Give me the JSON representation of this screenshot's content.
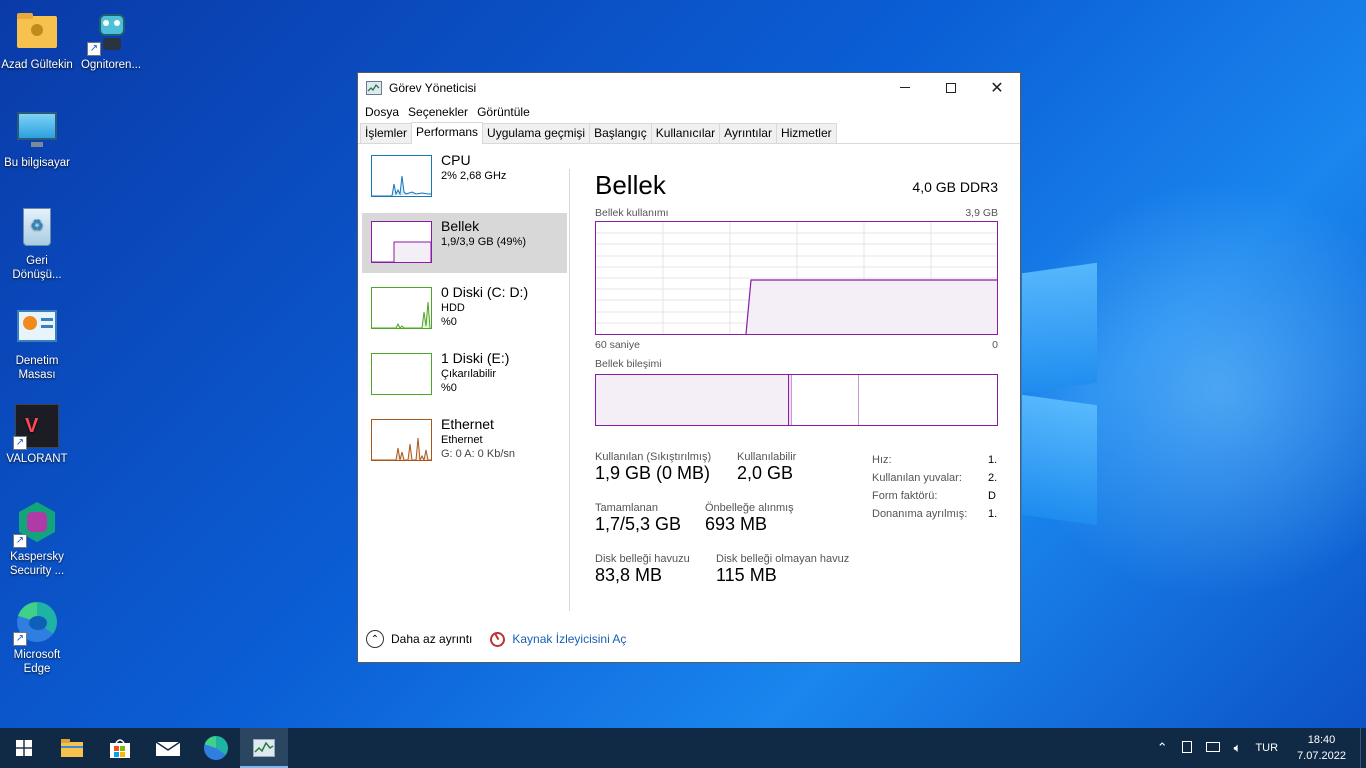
{
  "desktop": {
    "icons": [
      {
        "label": "Azad Gültekin",
        "icon": "user-folder-icon"
      },
      {
        "label": "Ognitoren...",
        "icon": "robot-app-icon"
      },
      {
        "label": "Bu bilgisayar",
        "icon": "monitor-icon"
      },
      {
        "label": "Geri Dönüşü...",
        "icon": "recycle-bin-icon"
      },
      {
        "label": "Denetim Masası",
        "icon": "control-panel-icon"
      },
      {
        "label": "VALORANT",
        "icon": "valorant-icon"
      },
      {
        "label": "Kaspersky Security ...",
        "icon": "kaspersky-icon"
      },
      {
        "label": "Microsoft Edge",
        "icon": "edge-icon"
      }
    ]
  },
  "window": {
    "title": "Görev Yöneticisi",
    "menu": [
      "Dosya",
      "Seçenekler",
      "Görüntüle"
    ],
    "tabs": [
      "İşlemler",
      "Performans",
      "Uygulama geçmişi",
      "Başlangıç",
      "Kullanıcılar",
      "Ayrıntılar",
      "Hizmetler"
    ],
    "active_tab": "Performans"
  },
  "perf_list": [
    {
      "name": "CPU",
      "sub": "2% 2,68 GHz",
      "sub2": "",
      "color": "#1778b8"
    },
    {
      "name": "Bellek",
      "sub": "1,9/3,9 GB (49%)",
      "sub2": "",
      "color": "#8b1aa6"
    },
    {
      "name": "0 Diski (C: D:)",
      "sub": "HDD",
      "sub2": "%0",
      "color": "#4ea625"
    },
    {
      "name": "1 Diski (E:)",
      "sub": "Çıkarılabilir",
      "sub2": "%0",
      "color": "#4ea625"
    },
    {
      "name": "Ethernet",
      "sub": "Ethernet",
      "sub2": "G: 0 A: 0 Kb/sn",
      "color": "#a8561a"
    }
  ],
  "memory": {
    "title": "Bellek",
    "spec": "4,0 GB DDR3",
    "usage_label": "Bellek kullanımı",
    "usage_max": "3,9 GB",
    "axis_left": "60 saniye",
    "axis_right": "0",
    "composition_label": "Bellek bileşimi",
    "stats": {
      "in_use_label": "Kullanılan (Sıkıştırılmış)",
      "in_use_value": "1,9 GB (0 MB)",
      "available_label": "Kullanılabilir",
      "available_value": "2,0 GB",
      "committed_label": "Tamamlanan",
      "committed_value": "1,7/5,3 GB",
      "cached_label": "Önbelleğe alınmış",
      "cached_value": "693 MB",
      "paged_label": "Disk belleği havuzu",
      "paged_value": "83,8 MB",
      "nonpaged_label": "Disk belleği olmayan havuz",
      "nonpaged_value": "115 MB"
    },
    "right_stats": [
      {
        "label": "Hız:",
        "value": "1."
      },
      {
        "label": "Kullanılan yuvalar:",
        "value": "2."
      },
      {
        "label": "Form faktörü:",
        "value": "D"
      },
      {
        "label": "Donanıma ayrılmış:",
        "value": "1."
      }
    ]
  },
  "footer": {
    "fewer_details": "Daha az ayrıntı",
    "resource_monitor": "Kaynak İzleyicisini Aç"
  },
  "taskbar": {
    "language": "TUR",
    "time": "18:40",
    "date": "7.07.2022"
  }
}
